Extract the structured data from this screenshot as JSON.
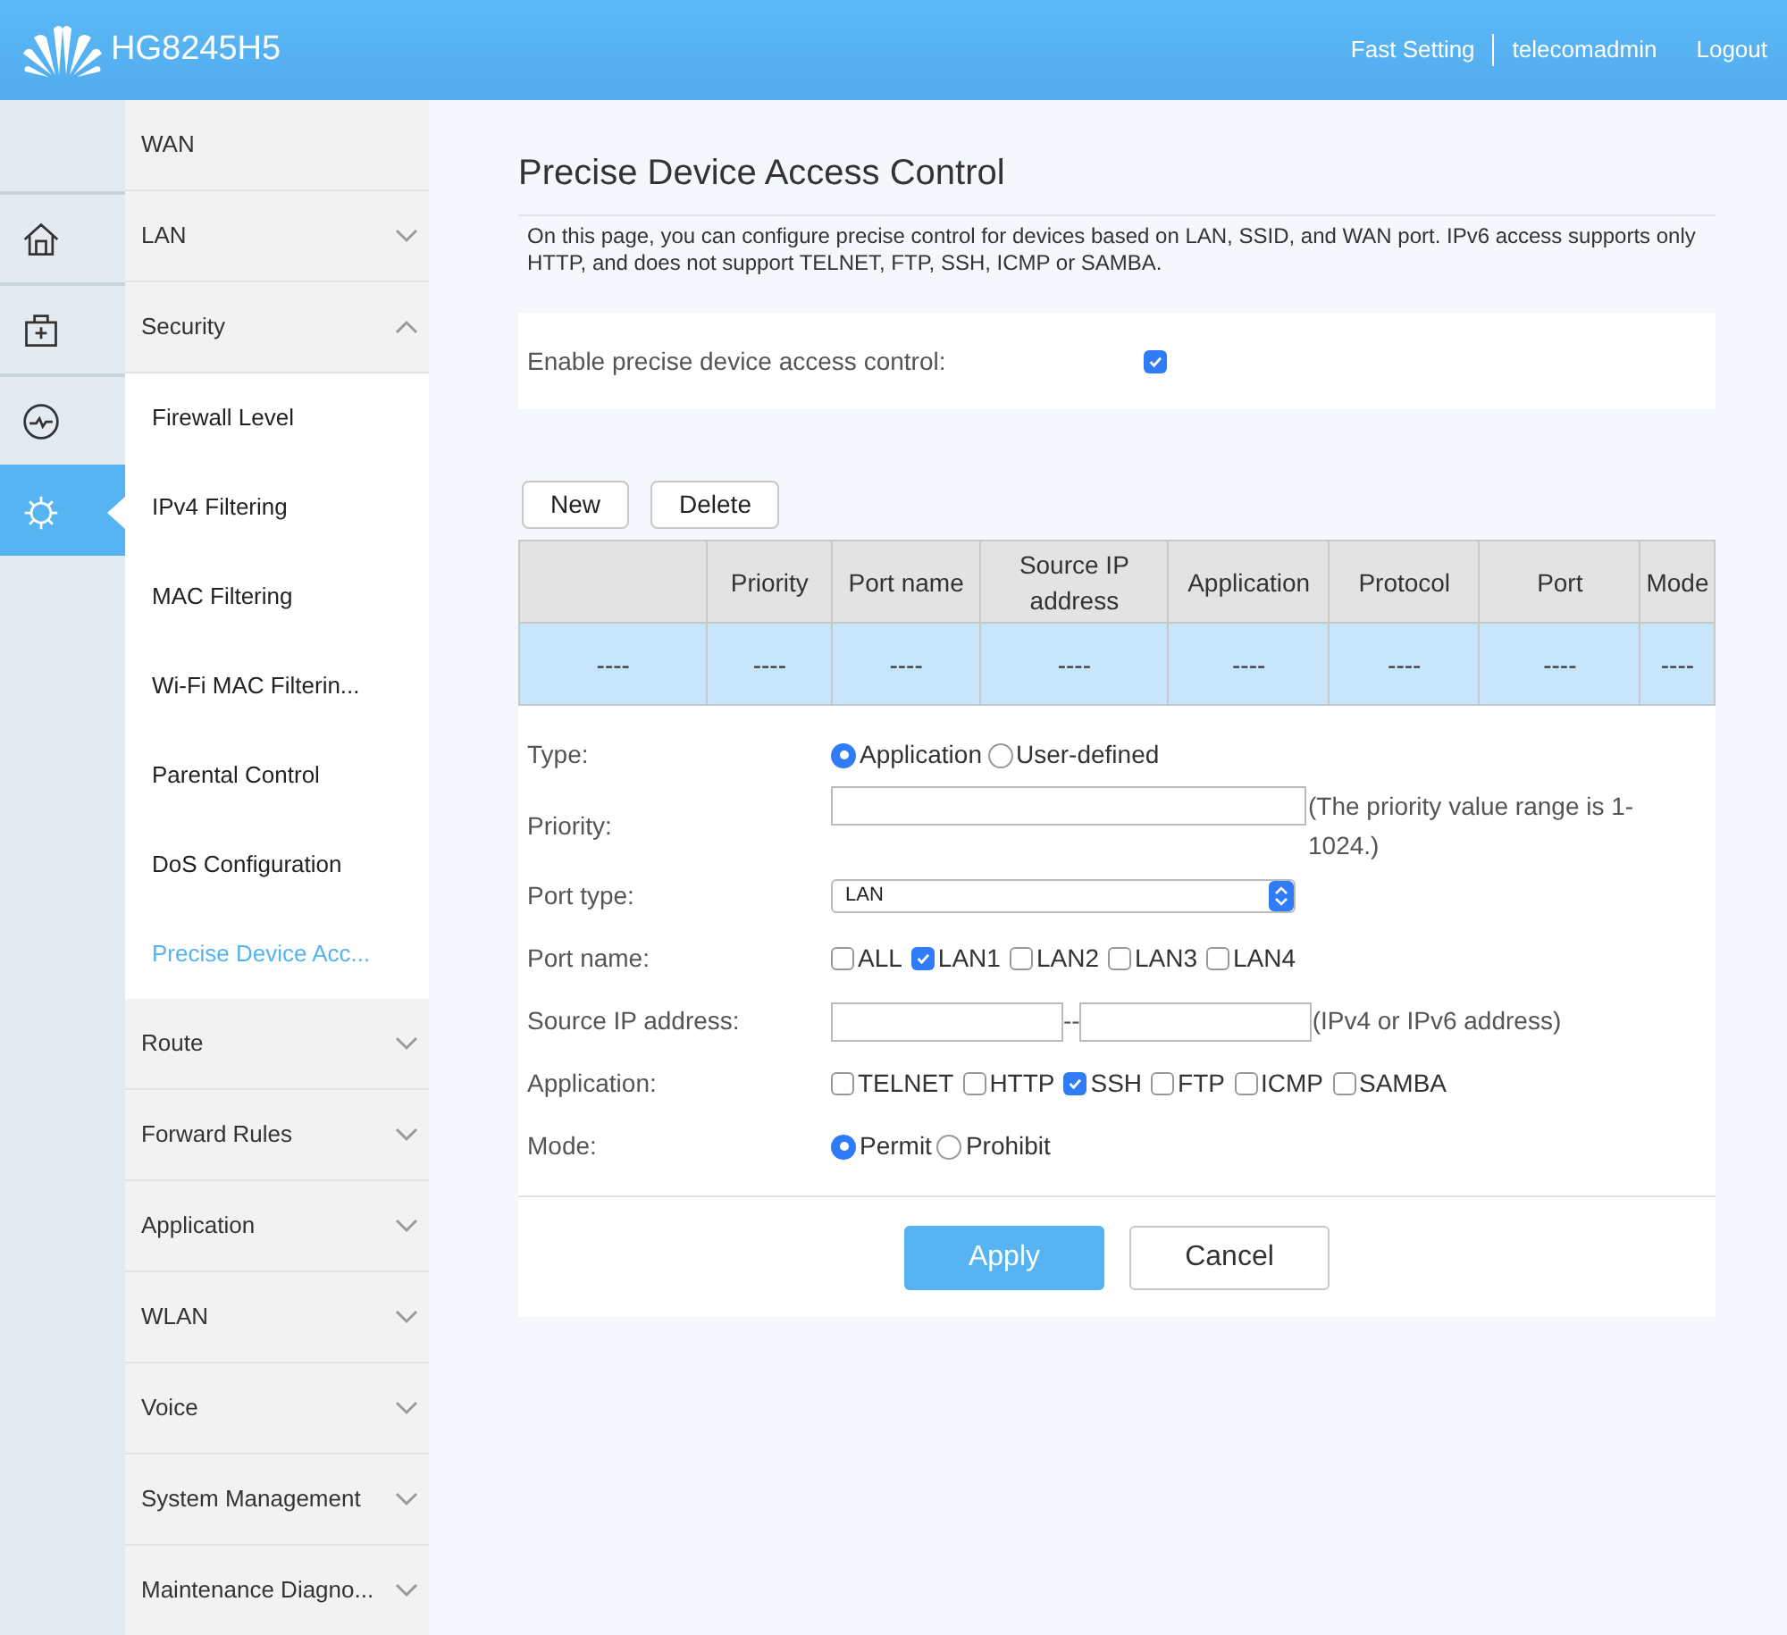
{
  "header": {
    "product": "HG8245H5",
    "links": [
      {
        "label": "Fast Setting"
      },
      {
        "label": "telecomadmin"
      },
      {
        "label": "Logout"
      }
    ]
  },
  "rail": [
    {
      "selected": false
    },
    {
      "selected": false
    },
    {
      "selected": false
    },
    {
      "selected": true
    }
  ],
  "menu": [
    {
      "label": "WAN",
      "kind": "link"
    },
    {
      "label": "LAN",
      "kind": "group",
      "expanded": false
    },
    {
      "label": "Security",
      "kind": "group",
      "expanded": true,
      "children": [
        {
          "label": "Firewall Level",
          "selected": false
        },
        {
          "label": "IPv4 Filtering",
          "selected": false
        },
        {
          "label": "MAC Filtering",
          "selected": false
        },
        {
          "label": "Wi-Fi MAC Filterin...",
          "selected": false
        },
        {
          "label": "Parental Control",
          "selected": false
        },
        {
          "label": "DoS Configuration",
          "selected": false
        },
        {
          "label": "Precise Device Acc...",
          "selected": true
        }
      ]
    },
    {
      "label": "Route",
      "kind": "group",
      "expanded": false
    },
    {
      "label": "Forward Rules",
      "kind": "group",
      "expanded": false
    },
    {
      "label": "Application",
      "kind": "group",
      "expanded": false
    },
    {
      "label": "WLAN",
      "kind": "group",
      "expanded": false
    },
    {
      "label": "Voice",
      "kind": "group",
      "expanded": false
    },
    {
      "label": "System Management",
      "kind": "group",
      "expanded": false
    },
    {
      "label": "Maintenance Diagno...",
      "kind": "group",
      "expanded": false
    }
  ],
  "page": {
    "title": "Precise Device Access Control",
    "description": "On this page, you can configure precise control for devices based on LAN, SSID, and WAN port. IPv6 access supports only HTTP, and does not support TELNET, FTP, SSH, ICMP or SAMBA.",
    "enable": {
      "label": "Enable precise device access control:",
      "checked": true
    }
  },
  "toolbar": [
    "New",
    "Delete"
  ],
  "table": {
    "columns": [
      "",
      "Priority",
      "Port name",
      "Source IP address",
      "Application",
      "Protocol",
      "Port",
      "Mode"
    ],
    "rows": [
      {
        "selected": true,
        "cells": [
          "----",
          "----",
          "----",
          "----",
          "----",
          "----",
          "----",
          "----"
        ]
      }
    ]
  },
  "form": [
    {
      "kind": "radio",
      "label": "Type:",
      "options": [
        {
          "label": "Application",
          "selected": true
        },
        {
          "label": "User-defined",
          "selected": false
        }
      ]
    },
    {
      "kind": "text",
      "label": "Priority:",
      "note": "(The priority value range is 1-1024.)"
    },
    {
      "kind": "select",
      "label": "Port type:",
      "value": "LAN"
    },
    {
      "kind": "checks",
      "label": "Port name:",
      "options": [
        {
          "label": "ALL",
          "checked": false
        },
        {
          "label": "LAN1",
          "checked": true
        },
        {
          "label": "LAN2",
          "checked": false
        },
        {
          "label": "LAN3",
          "checked": false
        },
        {
          "label": "LAN4",
          "checked": false
        }
      ]
    },
    {
      "kind": "range",
      "label": "Source IP address:",
      "separator": "--",
      "note": "(IPv4 or IPv6 address)"
    },
    {
      "kind": "checks",
      "label": "Application:",
      "options": [
        {
          "label": "TELNET",
          "checked": false
        },
        {
          "label": "HTTP",
          "checked": false
        },
        {
          "label": "SSH",
          "checked": true
        },
        {
          "label": "FTP",
          "checked": false
        },
        {
          "label": "ICMP",
          "checked": false
        },
        {
          "label": "SAMBA",
          "checked": false
        }
      ]
    },
    {
      "kind": "radio",
      "label": "Mode:",
      "options": [
        {
          "label": "Permit",
          "selected": true
        },
        {
          "label": "Prohibit",
          "selected": false
        }
      ]
    }
  ],
  "actions": {
    "primary": "Apply",
    "secondary": "Cancel"
  }
}
